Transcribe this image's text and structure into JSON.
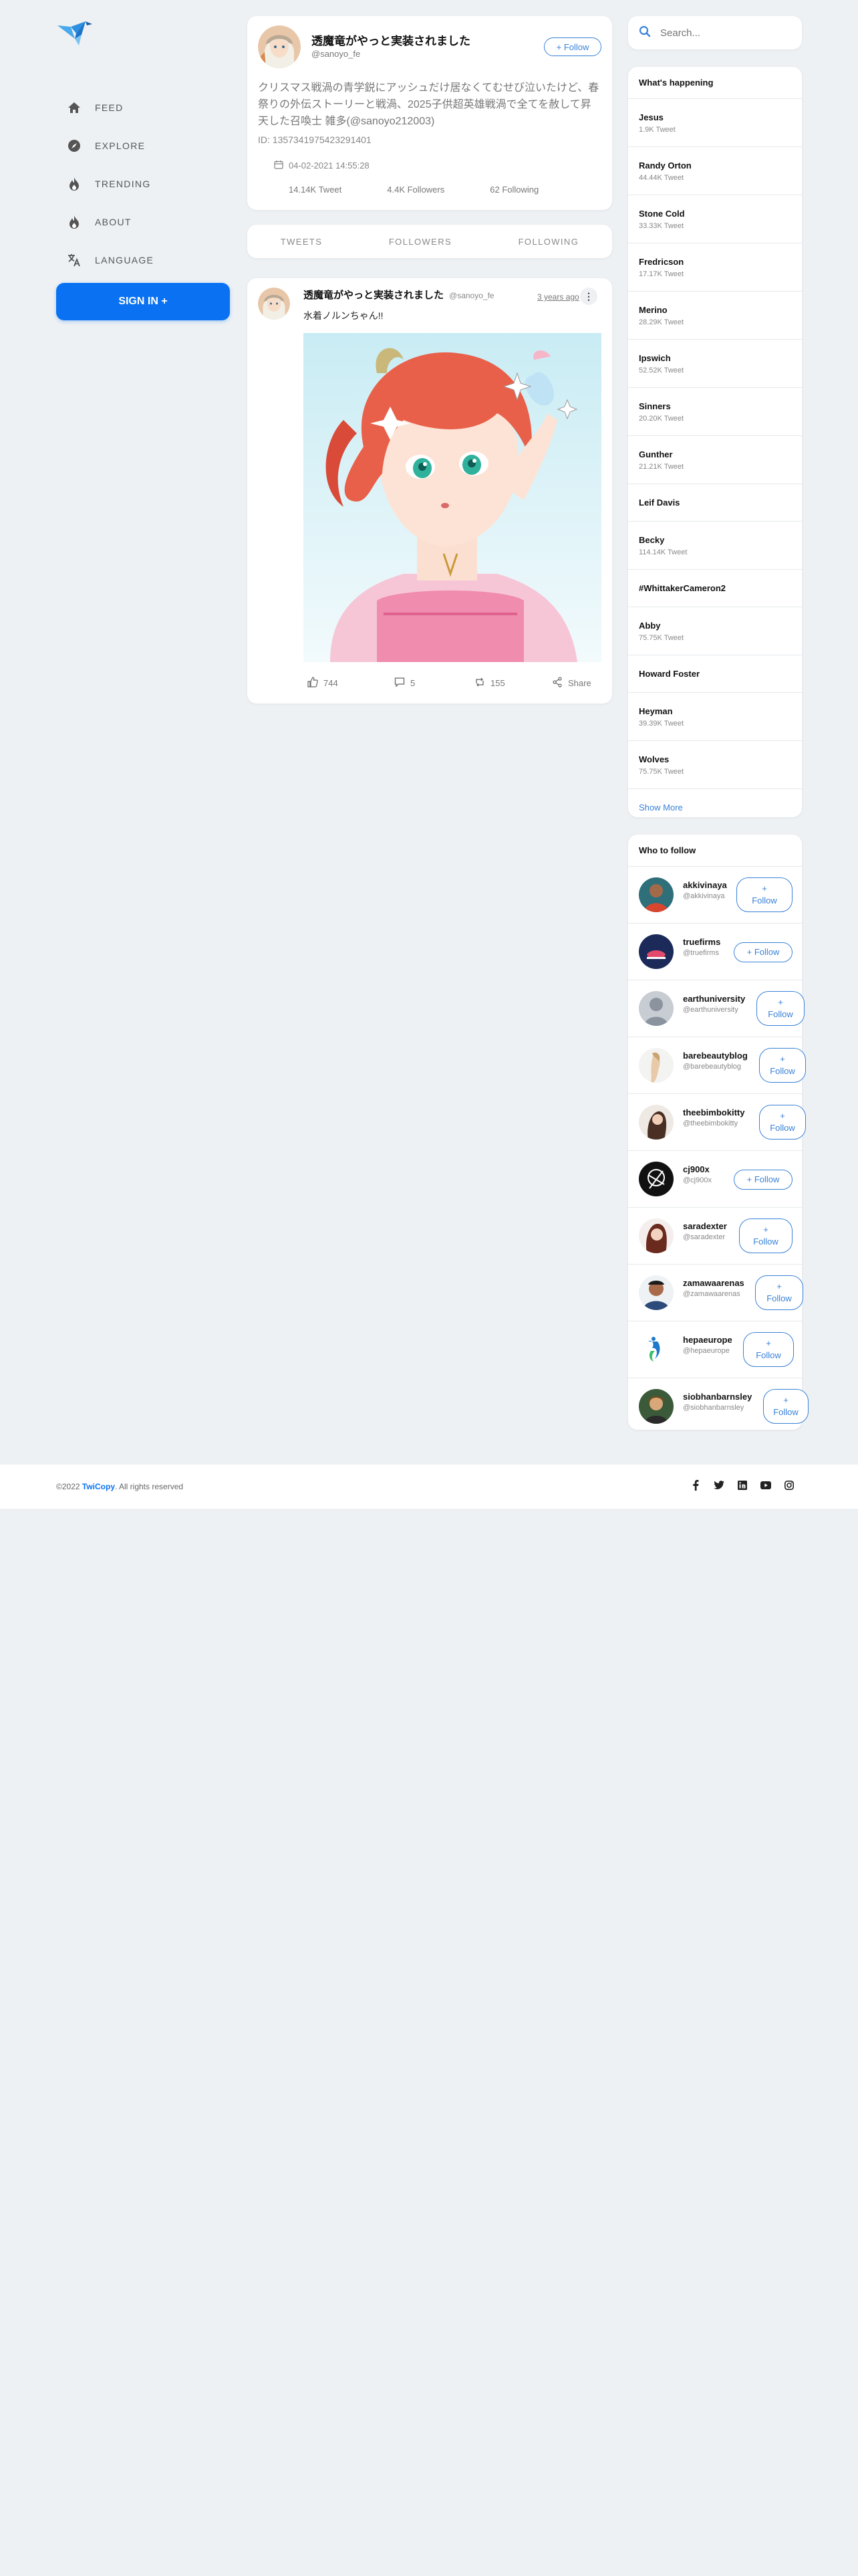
{
  "nav": {
    "items": [
      {
        "label": "FEED",
        "icon": "home-icon"
      },
      {
        "label": "EXPLORE",
        "icon": "compass-icon"
      },
      {
        "label": "TRENDING",
        "icon": "fire-icon"
      },
      {
        "label": "ABOUT",
        "icon": "fire-icon"
      },
      {
        "label": "LANGUAGE",
        "icon": "translate-icon"
      }
    ],
    "signin_label": "SIGN IN +"
  },
  "profile": {
    "name": "透魔竜がやっと実装されました",
    "handle": "@sanoyo_fe",
    "follow_label": "+ Follow",
    "bio": "クリスマス戦渦の青学鋭にアッシュだけ居なくてむせび泣いたけど、春祭りの外伝ストーリーと戦渦、2025子供超英雄戦渦で全てを赦して昇天した召喚士 雑多(@sanoyo212003)",
    "id_text": "ID: 1357341975423291401",
    "joined": "04-02-2021 14:55:28",
    "stats": {
      "tweets": "14.14K Tweet",
      "followers": "4.4K Followers",
      "following": "62 Following"
    }
  },
  "tabs": {
    "tweets": "TWEETS",
    "followers": "FOLLOWERS",
    "following": "FOLLOWING"
  },
  "tweet": {
    "name": "透魔竜がやっと実装されました",
    "handle": "@sanoyo_fe",
    "ago": "3 years ago",
    "more": "⋮",
    "text": "水着ノルンちゃん!!",
    "likes": "744",
    "replies": "5",
    "retweets": "155",
    "share": "Share"
  },
  "search": {
    "placeholder": "Search..."
  },
  "happening": {
    "title": "What's happening",
    "trends": [
      {
        "name": "Jesus",
        "count": "1.9K Tweet"
      },
      {
        "name": "Randy Orton",
        "count": "44.44K Tweet"
      },
      {
        "name": "Stone Cold",
        "count": "33.33K Tweet"
      },
      {
        "name": "Fredricson",
        "count": "17.17K Tweet"
      },
      {
        "name": "Merino",
        "count": "28.29K Tweet"
      },
      {
        "name": "Ipswich",
        "count": "52.52K Tweet"
      },
      {
        "name": "Sinners",
        "count": "20.20K Tweet"
      },
      {
        "name": "Gunther",
        "count": "21.21K Tweet"
      },
      {
        "name": "Leif Davis",
        "count": ""
      },
      {
        "name": "Becky",
        "count": "114.14K Tweet"
      },
      {
        "name": "#WhittakerCameron2",
        "count": ""
      },
      {
        "name": "Abby",
        "count": "75.75K Tweet"
      },
      {
        "name": "Howard Foster",
        "count": ""
      },
      {
        "name": "Heyman",
        "count": "39.39K Tweet"
      },
      {
        "name": "Wolves",
        "count": "75.75K Tweet"
      }
    ],
    "show_more": "Show More"
  },
  "who_to_follow": {
    "title": "Who to follow",
    "users": [
      {
        "name": "akkivinaya",
        "handle": "@akkivinaya",
        "follow": "+ Follow"
      },
      {
        "name": "truefirms",
        "handle": "@truefirms",
        "follow": "+ Follow"
      },
      {
        "name": "earthuniversity",
        "handle": "@earthuniversity",
        "follow": "+ Follow"
      },
      {
        "name": "barebeautyblog",
        "handle": "@barebeautyblog",
        "follow": "+ Follow"
      },
      {
        "name": "theebimbokitty",
        "handle": "@theebimbokitty",
        "follow": "+ Follow"
      },
      {
        "name": "cj900x",
        "handle": "@cj900x",
        "follow": "+ Follow"
      },
      {
        "name": "saradexter",
        "handle": "@saradexter",
        "follow": "+ Follow"
      },
      {
        "name": "zamawaarenas",
        "handle": "@zamawaarenas",
        "follow": "+ Follow"
      },
      {
        "name": "hepaeurope",
        "handle": "@hepaeurope",
        "follow": "+ Follow"
      },
      {
        "name": "siobhanbarnsley",
        "handle": "@siobhanbarnsley",
        "follow": "+ Follow"
      }
    ]
  },
  "footer": {
    "year": "©2022",
    "brand": "TwiCopy",
    "rights": ". All rights reserved"
  },
  "colors": {
    "accent": "#0a72f2",
    "link": "#3a82d8",
    "background": "#edf1f4"
  }
}
